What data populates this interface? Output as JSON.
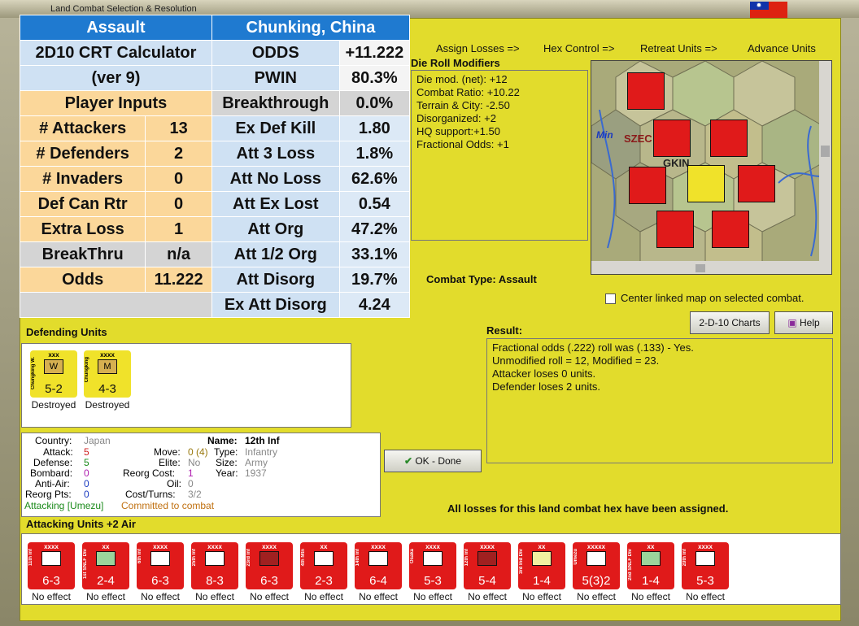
{
  "window": {
    "title": "Land Combat Selection & Resolution"
  },
  "crt": {
    "assault": "Assault",
    "location": "Chunking, China",
    "calc_title": "2D10 CRT Calculator",
    "calc_ver": "(ver 9)",
    "player_inputs": "Player Inputs",
    "inputs": [
      {
        "label": "# Attackers",
        "value": "13"
      },
      {
        "label": "# Defenders",
        "value": "2"
      },
      {
        "label": "# Invaders",
        "value": "0"
      },
      {
        "label": "Def Can Rtr",
        "value": "0"
      },
      {
        "label": "Extra Loss",
        "value": "1"
      },
      {
        "label": "BreakThru",
        "value": "n/a"
      },
      {
        "label": "Odds",
        "value": "11.222"
      }
    ],
    "results": [
      {
        "label": "ODDS",
        "value": "+11.222"
      },
      {
        "label": "PWIN",
        "value": "80.3%"
      },
      {
        "label": "Breakthrough",
        "value": "0.0%"
      },
      {
        "label": "Ex Def Kill",
        "value": "1.80"
      },
      {
        "label": "Att 3 Loss",
        "value": "1.8%"
      },
      {
        "label": "Att No Loss",
        "value": "62.6%"
      },
      {
        "label": "Att Ex Lost",
        "value": "0.54"
      },
      {
        "label": "Att Org",
        "value": "47.2%"
      },
      {
        "label": "Att 1/2 Org",
        "value": "33.1%"
      },
      {
        "label": "Att Disorg",
        "value": "19.7%"
      },
      {
        "label": "Ex Att Disorg",
        "value": "4.24"
      }
    ]
  },
  "toolbar": {
    "assign_losses": "Assign Losses =>",
    "hex_control": "Hex Control =>",
    "retreat_units": "Retreat Units =>",
    "advance_units": "Advance Units"
  },
  "die_mods": {
    "title": "Die Roll Modifiers",
    "lines": [
      "Die mod. (net): +12",
      "",
      "Combat Ratio: +10.22",
      "Terrain & City: -2.50",
      "Disorganized: +2",
      "HQ support:+1.50",
      "Fractional Odds: +1"
    ]
  },
  "map": {
    "labels": [
      "Min",
      "SZEC",
      "GKIN"
    ]
  },
  "combat_type": "Combat Type:  Assault",
  "center_map": "Center linked map on selected combat.",
  "buttons": {
    "charts": "2-D-10 Charts",
    "help": "Help",
    "ok": "OK - Done"
  },
  "defending": {
    "title": "Defending Units",
    "units": [
      {
        "name": "Chungking W.",
        "size": "xxx",
        "type": "W",
        "str": "5-2",
        "status": "Destroyed"
      },
      {
        "name": "Chungking",
        "size": "xxxx",
        "type": "M",
        "str": "4-3",
        "status": "Destroyed"
      }
    ]
  },
  "result": {
    "title": "Result:",
    "lines": [
      "Fractional odds (.222) roll was (.133)  - Yes.",
      "Unmodified roll = 12, Modified = 23.",
      "Attacker loses 0 units.",
      "Defender loses 2 units."
    ]
  },
  "unit_info": {
    "country_l": "Country:",
    "country": "Japan",
    "attack_l": "Attack:",
    "attack": "5",
    "defense_l": "Defense:",
    "defense": "5",
    "bombard_l": "Bombard:",
    "bombard": "0",
    "antiair_l": "Anti-Air:",
    "antiair": "0",
    "reorg_l": "Reorg Pts:",
    "reorg": "0",
    "move_l": "Move:",
    "move": "0 (4)",
    "elite_l": "Elite:",
    "elite": "No",
    "reorgcost_l": "Reorg Cost:",
    "reorgcost": "1",
    "oil_l": "Oil:",
    "oil": "0",
    "cost_l": "Cost/Turns:",
    "cost": "3/2",
    "name_l": "Name:",
    "name": "12th Inf",
    "type_l": "Type:",
    "type": "Infantry",
    "size_l": "Size:",
    "size": "Army",
    "year_l": "Year:",
    "year": "1937",
    "status_a": "Attacking [Umezu]",
    "status_b": "Committed to combat"
  },
  "loss_msg": "All losses for this land combat hex have been assigned.",
  "attacking": {
    "title": "Attacking Units +2 Air",
    "units": [
      {
        "name": "11th Inf",
        "size": "xxxx",
        "str": "6-3",
        "status": "No effect"
      },
      {
        "name": "1st SNLF Div",
        "size": "xx",
        "str": "2-4",
        "status": "No effect"
      },
      {
        "name": "6th Inf",
        "size": "xxxx",
        "str": "6-3",
        "status": "No effect"
      },
      {
        "name": "25th Inf",
        "size": "xxxx",
        "str": "8-3",
        "status": "No effect"
      },
      {
        "name": "23rd Inf",
        "size": "xxxx",
        "str": "6-3",
        "status": "No effect"
      },
      {
        "name": "4th Mtn",
        "size": "xx",
        "str": "2-3",
        "status": "No effect"
      },
      {
        "name": "14th Inf",
        "size": "xxxx",
        "str": "6-4",
        "status": "No effect"
      },
      {
        "name": "Osaka",
        "size": "xxxx",
        "str": "5-3",
        "status": "No effect"
      },
      {
        "name": "12th Inf",
        "size": "xxxx",
        "str": "5-4",
        "status": "No effect"
      },
      {
        "name": "3rd Ind Div",
        "size": "xx",
        "str": "1-4",
        "status": "No effect"
      },
      {
        "name": "Umezu",
        "size": "xxxxx",
        "str": "5(3)2",
        "status": "No effect"
      },
      {
        "name": "2nd SNLF Div",
        "size": "xx",
        "str": "1-4",
        "status": "No effect"
      },
      {
        "name": "20th Inf",
        "size": "xxxx",
        "str": "5-3",
        "status": "No effect"
      }
    ]
  }
}
